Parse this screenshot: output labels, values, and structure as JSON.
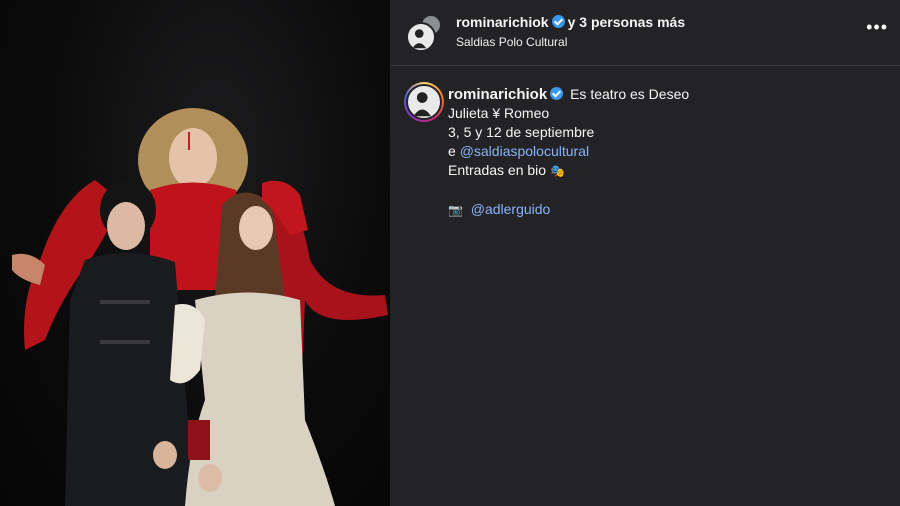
{
  "header": {
    "username": "rominarichiok",
    "others_text": "y 3 personas más",
    "location": "Saldias Polo Cultural",
    "more_icon": "•••"
  },
  "caption": {
    "username": "rominarichiok",
    "first_line": "Es teatro es Deseo",
    "line2": "Julieta ¥ Romeo",
    "line3": "3, 5 y 12 de septiembre",
    "line4_prefix": "e ",
    "line4_mention": "@saldiaspolocultural",
    "line5": "Entradas en bio",
    "line5_emoji": "🎭",
    "credit_emoji": "📷",
    "credit_mention": "@adlerguido"
  },
  "colors": {
    "panel_bg": "#232326",
    "link": "#8ab4f8",
    "verified": "#3897f0"
  }
}
